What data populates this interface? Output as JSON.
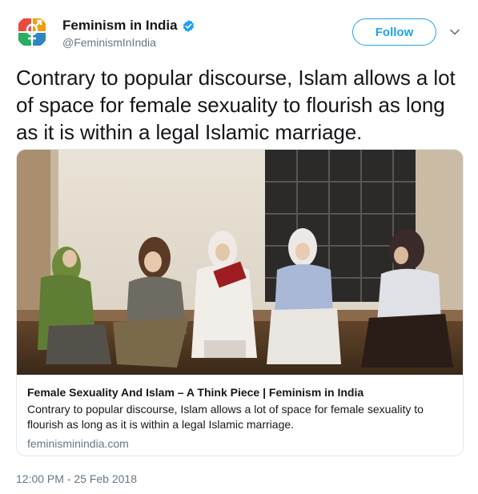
{
  "account": {
    "display_name": "Feminism in India",
    "handle": "@FeminismInIndia",
    "verified": true
  },
  "follow_button": {
    "label": "Follow"
  },
  "tweet": {
    "text": "Contrary to popular discourse, Islam allows a lot of space for female sexuality to flourish as long as it is within a legal Islamic marriage.",
    "timestamp": "12:00 PM - 25 Feb 2018"
  },
  "card": {
    "title": "Female Sexuality And Islam – A Think Piece | Feminism in India",
    "description": "Contrary to popular discourse, Islam allows a lot of space for female sexuality to flourish as long as it is within a legal Islamic marriage.",
    "domain": "feminisminindia.com"
  },
  "colors": {
    "accent": "#1da1f2",
    "secondary_text": "#657786",
    "border": "#e1e8ed"
  }
}
